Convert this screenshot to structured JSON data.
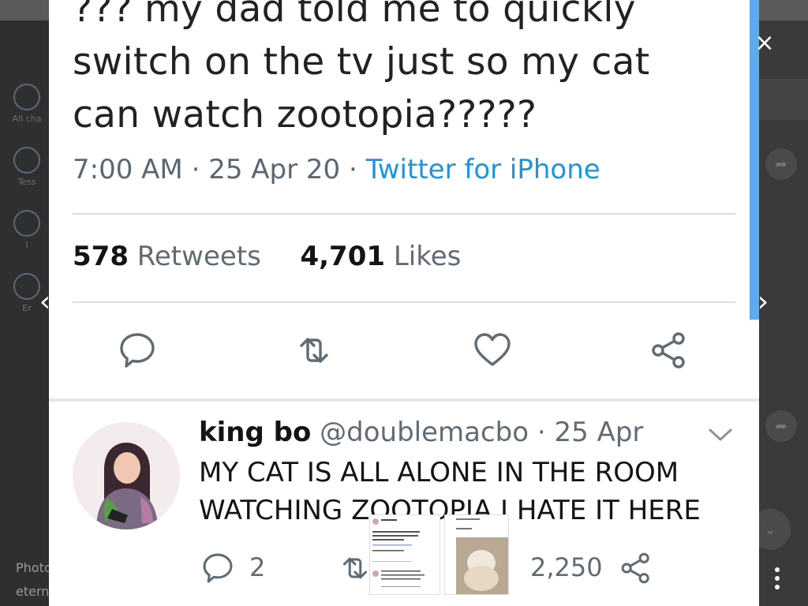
{
  "background_app": {
    "left_items": [
      {
        "label": "All cha",
        "icon": "chat-bubble-icon"
      },
      {
        "label": "Tess",
        "icon": "group-icon"
      },
      {
        "label": "I",
        "icon": "mask-icon"
      },
      {
        "label": "Er",
        "icon": "settings-sliders-icon"
      }
    ],
    "bottom_line1": "Photo",
    "bottom_line2": "etern"
  },
  "tweet": {
    "text": "??? my dad told me to quickly switch on the tv just so my cat can watch zootopia?????",
    "time": "7:00 AM",
    "date": "25 Apr 20",
    "source": "Twitter for iPhone",
    "retweets_count": "578",
    "retweets_label": "Retweets",
    "likes_count": "4,701",
    "likes_label": "Likes"
  },
  "reply": {
    "name": "king bo",
    "handle": "@doublemacbo",
    "date": "25 Apr",
    "text": "MY CAT IS ALL ALONE IN THE ROOM WATCHING ZOOTOPIA I HATE IT HERE",
    "replies_count": "2",
    "likes_count": "2,250"
  },
  "viewer": {
    "close_icon": "×",
    "prev_icon": "‹",
    "next_icon": "›"
  },
  "colors": {
    "link": "#1b95e0",
    "text": "#141414",
    "muted": "#606b74"
  }
}
